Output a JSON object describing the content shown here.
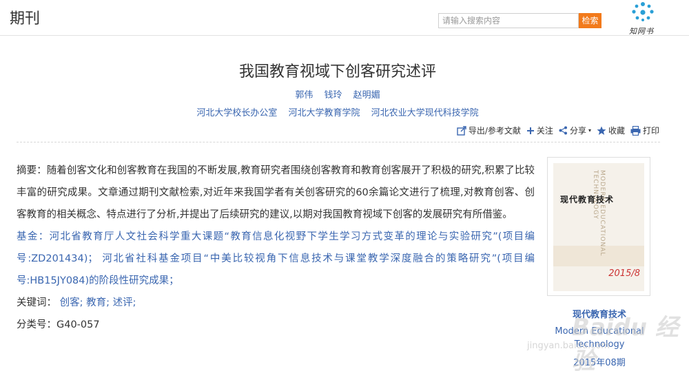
{
  "header": {
    "section_title": "期刊",
    "search_placeholder": "请输入搜索内容",
    "search_button": "检索",
    "logo_text": "知网书"
  },
  "article": {
    "title": "我国教育视域下创客研究述评",
    "authors": [
      "郭伟",
      "钱玲",
      "赵明媚"
    ],
    "orgs": [
      "河北大学校长办公室",
      "河北大学教育学院",
      "河北农业大学现代科技学院"
    ]
  },
  "tools": {
    "export": "导出/参考文献",
    "follow": "关注",
    "share": "分享",
    "favorite": "收藏",
    "print": "打印"
  },
  "abstract": {
    "label": "摘要：",
    "text": "随着创客文化和创客教育在我国的不断发展,教育研究者围绕创客教育和教育创客展开了积极的研究,积累了比较丰富的研究成果。文章通过期刊文献检索,对近年来我国学者有关创客研究的60余篇论文进行了梳理,对教育创客、创客教育的相关概念、特点进行了分析,并提出了后续研究的建议,以期对我国教育视域下创客的发展研究有所借鉴。"
  },
  "fund": {
    "label": "基金：",
    "text": "河北省教育厅人文社会科学重大课题“教育信息化视野下学生学习方式变革的理论与实验研究”(项目编号:ZD201434)； 河北省社科基金项目“中美比较视角下信息技术与课堂教学深度融合的策略研究”(项目编号:HB15JY084)的阶段性研究成果；"
  },
  "keywords": {
    "label": "关键词：",
    "items": [
      "创客;",
      "教育;",
      "述评;"
    ]
  },
  "classification": {
    "label": "分类号：",
    "value": "G40-057"
  },
  "journal": {
    "cover_title": "现代教育技术",
    "cover_vertical": "MODERN EDUCATIONAL TECHNOLOGY",
    "cover_issue": "2015/8",
    "name": "现代教育技术",
    "english_name": "Modern Educational Technology",
    "issue": "2015年08期"
  },
  "watermark": {
    "brand": "Baidu 经验",
    "url": "jingyan.baidu.com"
  },
  "colors": {
    "link": "#3a66b0",
    "search_button": "#f27a1b"
  }
}
